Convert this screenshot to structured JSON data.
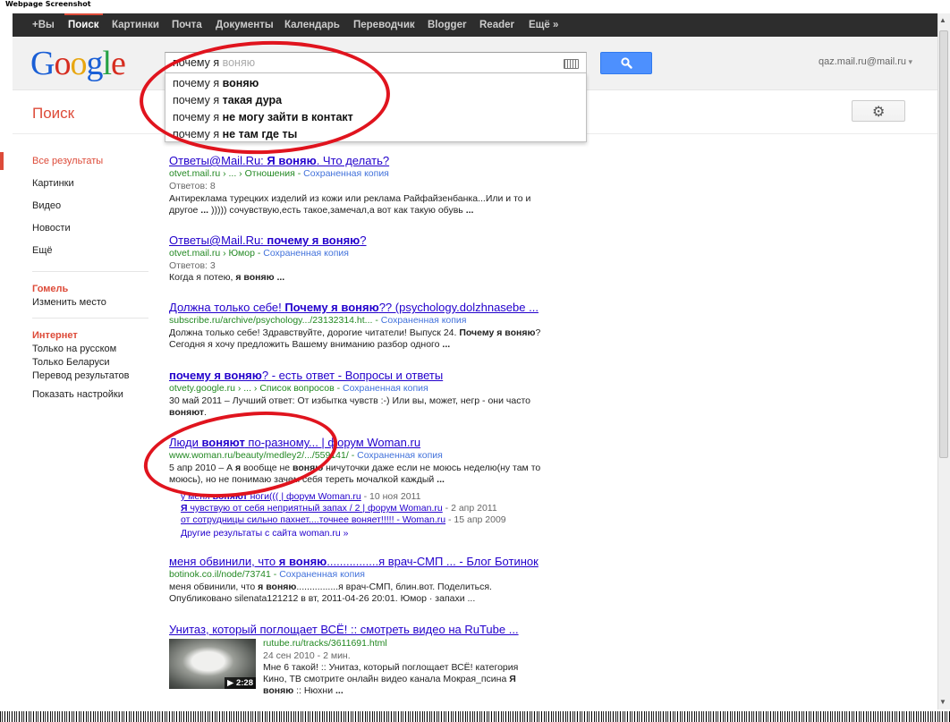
{
  "page": {
    "caption": "Webpage Screenshot"
  },
  "topbar": {
    "items": [
      "+Вы",
      "Поиск",
      "Картинки",
      "Почта",
      "Документы",
      "Календарь",
      "Переводчик",
      "Blogger",
      "Reader",
      "Ещё »"
    ],
    "active_index": 1
  },
  "header": {
    "logo": "Google",
    "search": {
      "typed": "почему я ",
      "hint": "воняю"
    },
    "account": "qaz.mail.ru@mail.ru"
  },
  "suggestions": [
    {
      "prefix": "почему я ",
      "completion": "воняю"
    },
    {
      "prefix": "почему я ",
      "completion": "такая дура"
    },
    {
      "prefix": "почему я ",
      "completion": "не могу зайти в контакт"
    },
    {
      "prefix": "почему я ",
      "completion": "не там где ты"
    }
  ],
  "subheader": {
    "title": "Поиск"
  },
  "leftnav": {
    "types": [
      "Все результаты",
      "Картинки",
      "Видео",
      "Новости",
      "Ещё"
    ],
    "location": {
      "heading": "Гомель",
      "change": "Изменить место"
    },
    "filters": {
      "heading": "Интернет",
      "items": [
        "Только на русском",
        "Только Беларуси",
        "Перевод результатов"
      ]
    },
    "settings": "Показать настройки"
  },
  "results": {
    "r1": {
      "title_a": "Ответы@Mail.Ru: ",
      "title_b": "Я воняю",
      "title_c": ". Что делать?",
      "url": "otvet.mail.ru › ... › Отношения",
      "cache": "Сохраненная копия",
      "meta": "Ответов: 8",
      "snip_a": "Антиреклама турецких изделий из кожи или реклама Райфайзенбанка...Или и то и другое ",
      "snip_b": "...",
      "snip_c": " ))))) сочувствую,есть такое,замечал,а вот как такую обувь ",
      "snip_d": "..."
    },
    "r2": {
      "title_a": "Ответы@Mail.Ru: ",
      "title_b": "почему я воняю",
      "title_c": "?",
      "url": "otvet.mail.ru › Юмор",
      "cache": "Сохраненная копия",
      "meta": "Ответов: 3",
      "snip_a": "Когда я потею, ",
      "snip_b": "я воняю ..."
    },
    "r3": {
      "title_a": "Должна только себе! ",
      "title_b": "Почему я воняю",
      "title_c": "?? (psychology.dolzhnasebe ...",
      "url": "subscribe.ru/archive/psychology.../23132314.ht...",
      "cache": "Сохраненная копия",
      "snip_a": "Должна только себе! Здравствуйте, дорогие читатели! Выпуск 24. ",
      "snip_b": "Почему я воняю",
      "snip_c": "? Сегодня я хочу предложить Вашему вниманию разбор одного ",
      "snip_d": "..."
    },
    "r4": {
      "title_a": "почему я воняю",
      "title_b": "? - есть ответ - Вопросы и ответы",
      "url": "otvety.google.ru › ... › Список вопросов",
      "cache": "Сохраненная копия",
      "snip_a": "30 май 2011 – Лучший ответ: От избытка чувств :-) Или вы, может, негр - они часто ",
      "snip_b": "воняют",
      "snip_c": "."
    },
    "r5": {
      "title_a": "Люди ",
      "title_b": "воняют",
      "title_c": " по-разному... | форум Woman.ru",
      "url": "www.woman.ru/beauty/medley2/.../559141/",
      "cache": "Сохраненная копия",
      "snip_a": "5 апр 2010 – А ",
      "snip_b": "я",
      "snip_c": " вообще не ",
      "snip_d": "воняю",
      "snip_e": " ничуточки даже если не моюсь неделю(ну там то моюсь), но не понимаю зачем себя тереть мочалкой каждый ",
      "snip_f": "...",
      "sitelinks": [
        {
          "a": "у меня ",
          "b": "воняют",
          "c": " ноги((( | форум Woman.ru",
          "date": " - 10 ноя 2011"
        },
        {
          "a": "",
          "b": "Я",
          "c": " чувствую от себя неприятный запах / 2 | форум Woman.ru",
          "date": " - 2 апр 2011"
        },
        {
          "a": "от сотрудницы сильно пахнет....точнее воняет!!!!! - Woman.ru",
          "b": "",
          "c": "",
          "date": " - 15 апр 2009"
        }
      ],
      "more": "Другие результаты с сайта woman.ru »"
    },
    "r6": {
      "title_a": "меня обвинили, что ",
      "title_b": "я воняю",
      "title_c": "................я врач-СМП ... - Блог Ботинок",
      "url": "botinok.co.il/node/73741",
      "cache": "Сохраненная копия",
      "snip_a": "меня обвинили, что ",
      "snip_b": "я воняю",
      "snip_c": "................я врач-СМП, блин.вот. Поделиться.",
      "snip_d": "Опубликовано silenata121212 в вт, 2011-04-26 20:01. Юмор · запахи ..."
    },
    "r7": {
      "title": "Унитаз, который поглощает ВСЁ! :: смотреть видео на RuTube ...",
      "url": "rutube.ru/tracks/3611691.html",
      "meta": "24 сен 2010 - 2 мин.",
      "snip_a": "Мне 6 такой! :: Унитаз, который поглощает ВСЁ! категория Кино, ТВ смотрите онлайн видео канала Мокрая_псина ",
      "snip_b": "Я воняю",
      "snip_c": " :: Нюхни ",
      "snip_d": "...",
      "duration": "2:28"
    }
  },
  "colors": {
    "topbar": "#2d2d2d",
    "accent": "#dd4b39",
    "link": "#2200cc",
    "url": "#228822",
    "marker": "#e0141e",
    "search_button": "#4d90fe"
  }
}
